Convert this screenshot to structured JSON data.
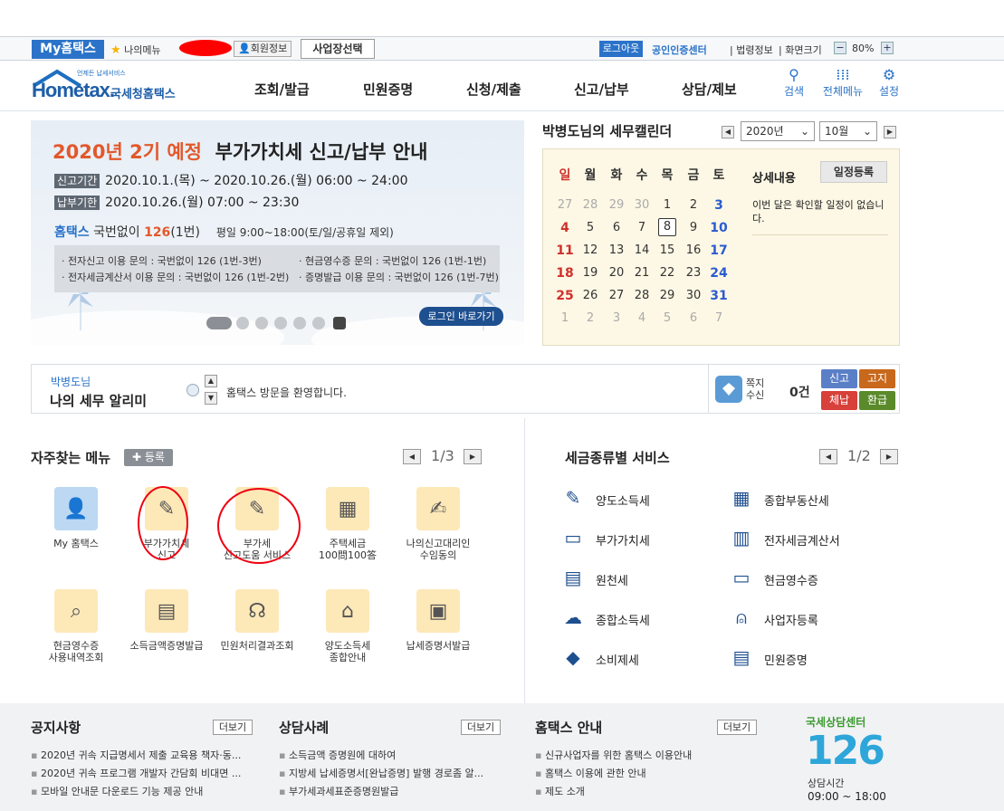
{
  "topbar": {
    "myhome": "My홈택스",
    "mymenu": "나의메뉴",
    "member_info": "회원정보",
    "biz_select": "사업장선택",
    "logout": "로그아웃",
    "cert_center": "공인인증센터",
    "law_info": "법령정보",
    "zoom_label": "화면크기",
    "zoom_value": "80%",
    "zoom_minus": "−",
    "zoom_plus": "+"
  },
  "header": {
    "logo_small": "언제든 납세서비스",
    "logo_name": "Hometax.",
    "logo_sub": "국세청홈택스",
    "nav": [
      "조회/발급",
      "민원증명",
      "신청/제출",
      "신고/납부",
      "상담/제보"
    ],
    "util": [
      {
        "label": "검색",
        "icon": "search-icon"
      },
      {
        "label": "전체메뉴",
        "icon": "grid-icon"
      },
      {
        "label": "설정",
        "icon": "gear-icon"
      }
    ]
  },
  "banner": {
    "title_red": "2020년 2기 예정",
    "title_rest": "부가가치세 신고/납부 안내",
    "period_tag": "신고기간",
    "period": "2020.10.1.(목) ~ 2020.10.26.(월) 06:00 ~ 24:00",
    "deadline_tag": "납부기한",
    "deadline": "2020.10.26.(월) 07:00 ~ 23:30",
    "hotline_name": "홈택스",
    "hotline_a": "국번없이",
    "hotline_num": "126",
    "hotline_b": "(1번)",
    "hotline_hours": "평일 9:00~18:00(토/일/공휴일 제외)",
    "info": [
      "· 전자신고 이용 문의 : 국번없이 126 (1번-3번)",
      "· 전자세금계산서 이용 문의 : 국번없이 126 (1번-2번)",
      "· 현금영수증 문의 : 국번없이 126 (1번-1번)",
      "· 증명발급 이용 문의 : 국번없이 126 (1번-7번)"
    ],
    "login_button": "로그인 바로가기"
  },
  "calendar": {
    "title": "박병도님의 세무캘린더",
    "year": "2020년",
    "month": "10월",
    "weekdays": [
      "일",
      "월",
      "화",
      "수",
      "목",
      "금",
      "토"
    ],
    "weeks": [
      [
        "27",
        "28",
        "29",
        "30",
        "1",
        "2",
        "3"
      ],
      [
        "4",
        "5",
        "6",
        "7",
        "8",
        "9",
        "10"
      ],
      [
        "11",
        "12",
        "13",
        "14",
        "15",
        "16",
        "17"
      ],
      [
        "18",
        "19",
        "20",
        "21",
        "22",
        "23",
        "24"
      ],
      [
        "25",
        "26",
        "27",
        "28",
        "29",
        "30",
        "31"
      ],
      [
        "1",
        "2",
        "3",
        "4",
        "5",
        "6",
        "7"
      ]
    ],
    "today": "8",
    "detail_label": "상세내용",
    "schedule_button": "일정등록",
    "schedule_text": "이번 달은 확인할 일정이 없습니다."
  },
  "notice": {
    "user": "박병도님",
    "title": "나의 세무 알리미",
    "message": "홈택스 방문을 환영합니다.",
    "note_label_1": "쪽지",
    "note_label_2": "수신",
    "count": "0건",
    "buttons": [
      {
        "label": "신고",
        "color": "#5b7fc7"
      },
      {
        "label": "고지",
        "color": "#c8681b"
      },
      {
        "label": "체납",
        "color": "#d8403a"
      },
      {
        "label": "환급",
        "color": "#5a8a2a"
      }
    ]
  },
  "quick_menu": {
    "title": "자주찾는 메뉴",
    "add_label": "✚ 등록",
    "page_current": "1",
    "page_total": "3",
    "items": [
      {
        "label": "My 홈택스",
        "icon": "user-icon"
      },
      {
        "label": "부가가치세\n신고",
        "icon": "vat-form-icon"
      },
      {
        "label": "부가세\n신고도움 서비스",
        "icon": "vat-help-icon"
      },
      {
        "label": "주택세금\n100問100答",
        "icon": "building-icon"
      },
      {
        "label": "나의신고대리인\n수임동의",
        "icon": "sign-icon"
      },
      {
        "label": "현금영수증\n사용내역조회",
        "icon": "receipt-search-icon"
      },
      {
        "label": "소득금액증명발급",
        "icon": "printer-icon"
      },
      {
        "label": "민원처리결과조회",
        "icon": "headset-icon"
      },
      {
        "label": "양도소득세\n종합안내",
        "icon": "house-search-icon"
      },
      {
        "label": "납세증명서발급",
        "icon": "certificate-icon"
      }
    ]
  },
  "tax_service": {
    "title": "세금종류별 서비스",
    "page_current": "1",
    "page_total": "2",
    "left": [
      {
        "label": "양도소득세",
        "icon": "transfer-doc-icon"
      },
      {
        "label": "부가가치세",
        "icon": "vat-icon"
      },
      {
        "label": "원천세",
        "icon": "withholding-icon"
      },
      {
        "label": "종합소득세",
        "icon": "income-tax-icon"
      },
      {
        "label": "소비제세",
        "icon": "diamond-icon"
      }
    ],
    "right": [
      {
        "label": "종합부동산세",
        "icon": "realestate-icon"
      },
      {
        "label": "전자세금계산서",
        "icon": "invoice-icon"
      },
      {
        "label": "현금영수증",
        "icon": "cash-receipt-icon"
      },
      {
        "label": "사업자등록",
        "icon": "person-icon"
      },
      {
        "label": "민원증명",
        "icon": "document-icon"
      }
    ]
  },
  "footer": {
    "more": "더보기",
    "notices": {
      "title": "공지사항",
      "items": [
        "2020년 귀속 지급명세서 제출 교육용 책자·동...",
        "2020년 귀속 프로그램 개발자 간담회 비대면 ...",
        "모바일 안내문 다운로드 기능 제공 안내"
      ]
    },
    "cases": {
      "title": "상담사례",
      "items": [
        "소득금액 증명원에 대하여",
        "지방세 납세증명서[완납증명] 발행 경로좀 알...",
        "부가세과세표준증명원발급"
      ]
    },
    "guide": {
      "title": "홈택스 안내",
      "items": [
        "신규사업자를 위한 홈택스 이용안내",
        "홈택스 이용에 관한 안내",
        "제도 소개"
      ]
    },
    "center": {
      "title": "국세상담센터",
      "number": "126",
      "hours_label": "상담시간",
      "hours": "09:00 ~ 18:00"
    }
  }
}
